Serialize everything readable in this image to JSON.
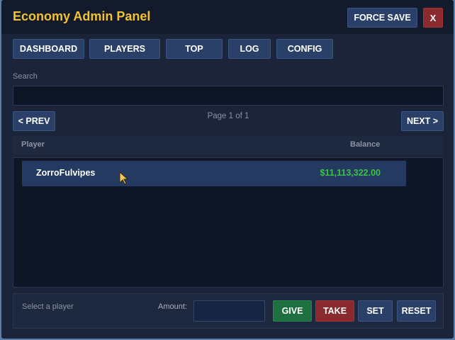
{
  "header": {
    "title": "Economy Admin Panel",
    "force_save_label": "FORCE SAVE",
    "close_label": "X"
  },
  "tabs": [
    "DASHBOARD",
    "PLAYERS",
    "TOP",
    "LOG",
    "CONFIG"
  ],
  "search": {
    "label": "Search",
    "value": "",
    "placeholder": ""
  },
  "pagination": {
    "prev_label": "< PREV",
    "page_info": "Page 1 of 1",
    "next_label": "NEXT >"
  },
  "table": {
    "columns": [
      "Player",
      "Balance"
    ],
    "rows": [
      {
        "player": "ZorroFulvipes",
        "balance": "$11,113,322.00"
      }
    ]
  },
  "footer": {
    "selection_status": "Select a player",
    "amount_label": "Amount:",
    "amount_value": "",
    "give_label": "GIVE",
    "take_label": "TAKE",
    "set_label": "SET",
    "reset_label": "RESET"
  },
  "colors": {
    "title": "#f2c230",
    "balance": "#3cc24a",
    "give": "#1f7040",
    "take": "#8a2a2e",
    "button": "#2b4068"
  }
}
